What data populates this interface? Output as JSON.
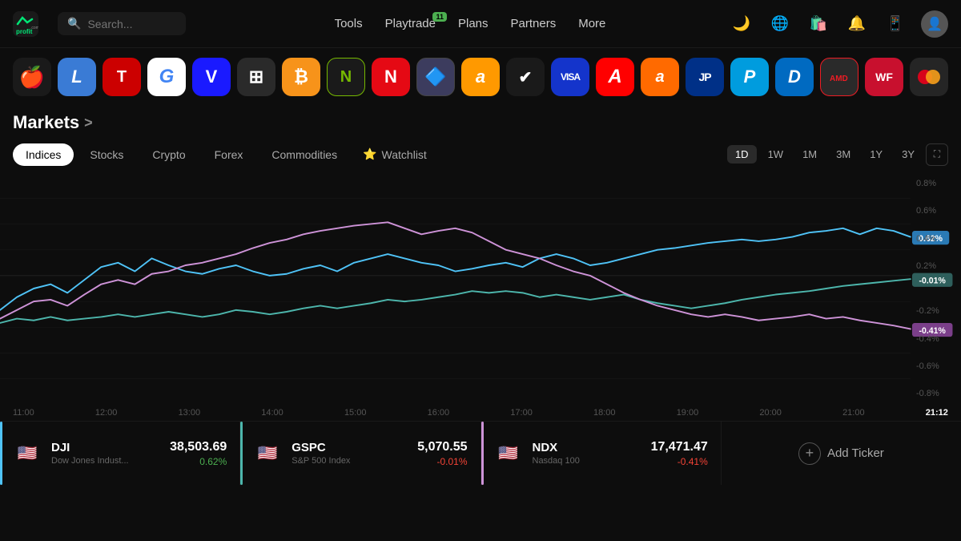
{
  "header": {
    "logo_text": "profit",
    "logo_badge": ".com",
    "search_placeholder": "Search...",
    "nav": [
      {
        "label": "Tools",
        "badge": null
      },
      {
        "label": "Playtrade",
        "badge": "11"
      },
      {
        "label": "Plans",
        "badge": null
      },
      {
        "label": "Partners",
        "badge": null
      },
      {
        "label": "More",
        "badge": null
      }
    ],
    "icons": [
      "moon",
      "globe",
      "shopping-bag",
      "bell",
      "mobile",
      "user"
    ]
  },
  "tickers": [
    {
      "symbol": "AAPL",
      "color": "#1a1a1a",
      "text": "",
      "emoji": "🍎",
      "bg": "#1a1a1a"
    },
    {
      "symbol": "LTC",
      "color": "#3a7bd5",
      "text": "L",
      "emoji": "L",
      "bg": "#3a7bd5"
    },
    {
      "symbol": "TSLA",
      "color": "#cc0000",
      "text": "T",
      "emoji": "T",
      "bg": "#cc0000"
    },
    {
      "symbol": "GOOG",
      "color": "#4285f4",
      "text": "G",
      "emoji": "G",
      "bg": "#4285f4"
    },
    {
      "symbol": "V",
      "color": "#1a1aff",
      "text": "V",
      "emoji": "V",
      "bg": "#1a1aff"
    },
    {
      "symbol": "MSFT",
      "color": "#ea3e23",
      "text": "⊞",
      "emoji": "⊞",
      "bg": "#2a2a2a"
    },
    {
      "symbol": "BTC",
      "color": "#f7931a",
      "text": "₿",
      "emoji": "₿",
      "bg": "#f7931a"
    },
    {
      "symbol": "NVDA",
      "color": "#76b900",
      "text": "N",
      "emoji": "N",
      "bg": "#1a1a1a"
    },
    {
      "symbol": "NFLX",
      "color": "#e50914",
      "text": "N",
      "emoji": "N",
      "bg": "#e50914"
    },
    {
      "symbol": "ETH",
      "color": "#627eea",
      "text": "Ξ",
      "emoji": "Ξ",
      "bg": "#3c3c5e"
    },
    {
      "symbol": "AMZN",
      "color": "#ff9900",
      "text": "a",
      "emoji": "a",
      "bg": "#ff9900"
    },
    {
      "symbol": "NKE",
      "color": "#000",
      "text": "✓",
      "emoji": "✓",
      "bg": "#1a1a1a"
    },
    {
      "symbol": "VISA",
      "color": "#1434cb",
      "text": "VISA",
      "emoji": "VISA",
      "bg": "#1434cb"
    },
    {
      "symbol": "ADBE",
      "color": "#ff0000",
      "text": "A",
      "emoji": "A",
      "bg": "#ff0000"
    },
    {
      "symbol": "BABA",
      "color": "#ff6a00",
      "text": "a",
      "emoji": "a",
      "bg": "#ff6a00"
    },
    {
      "symbol": "JPM",
      "color": "#003087",
      "text": "JP",
      "emoji": "JP",
      "bg": "#003087"
    },
    {
      "symbol": "PYPL",
      "color": "#009cde",
      "text": "P",
      "emoji": "P",
      "bg": "#009cde"
    },
    {
      "symbol": "DIS",
      "color": "#006ac1",
      "text": "D",
      "emoji": "D",
      "bg": "#006ac1"
    },
    {
      "symbol": "AMD",
      "color": "#ed1c24",
      "text": "A",
      "emoji": "A",
      "bg": "#2a2a2a"
    },
    {
      "symbol": "WF",
      "color": "#c8102e",
      "text": "WF",
      "emoji": "WF",
      "bg": "#c8102e"
    },
    {
      "symbol": "MC",
      "color": "#eb001b",
      "text": "⬤",
      "emoji": "⬤",
      "bg": "#252525"
    }
  ],
  "markets": {
    "title": "Markets",
    "arrow": ">",
    "tabs": [
      {
        "label": "Indices",
        "active": true
      },
      {
        "label": "Stocks",
        "active": false
      },
      {
        "label": "Crypto",
        "active": false
      },
      {
        "label": "Forex",
        "active": false
      },
      {
        "label": "Commodities",
        "active": false
      },
      {
        "label": "Watchlist",
        "active": false,
        "star": true
      }
    ],
    "time_controls": [
      "1D",
      "1W",
      "1M",
      "3M",
      "1Y",
      "3Y"
    ],
    "active_time": "1D"
  },
  "chart": {
    "x_labels": [
      "11:00",
      "12:00",
      "13:00",
      "14:00",
      "15:00",
      "16:00",
      "17:00",
      "18:00",
      "19:00",
      "20:00",
      "21:00",
      "21:12"
    ],
    "y_labels": [
      "0.8%",
      "0.6%",
      "0.4%",
      "0.2%",
      "0%",
      "-0.2%",
      "-0.4%",
      "-0.6%",
      "-0.8%"
    ],
    "series": [
      {
        "name": "DJI",
        "color": "#4fc3f7",
        "value_label": "0.62%",
        "label_bg": "#2a7ab5"
      },
      {
        "name": "GSPC",
        "color": "#4db6ac",
        "value_label": "-0.01%",
        "label_bg": "#2e5f5c"
      },
      {
        "name": "NDX",
        "color": "#ce93d8",
        "value_label": "-0.41%",
        "label_bg": "#7b3f8a"
      }
    ]
  },
  "ticker_cards": [
    {
      "symbol": "DJI",
      "name": "Dow Jones Indust...",
      "price": "38,503.69",
      "change": "0.62%",
      "positive": true,
      "flag": "🇺🇸",
      "bar_color": "#4fc3f7"
    },
    {
      "symbol": "GSPC",
      "name": "S&P 500 Index",
      "price": "5,070.55",
      "change": "-0.01%",
      "positive": false,
      "flag": "🇺🇸",
      "bar_color": "#4db6ac"
    },
    {
      "symbol": "NDX",
      "name": "Nasdaq 100",
      "price": "17,471.47",
      "change": "-0.41%",
      "positive": false,
      "flag": "🇺🇸",
      "bar_color": "#ce93d8"
    },
    {
      "add_ticker_label": "Add Ticker"
    }
  ]
}
